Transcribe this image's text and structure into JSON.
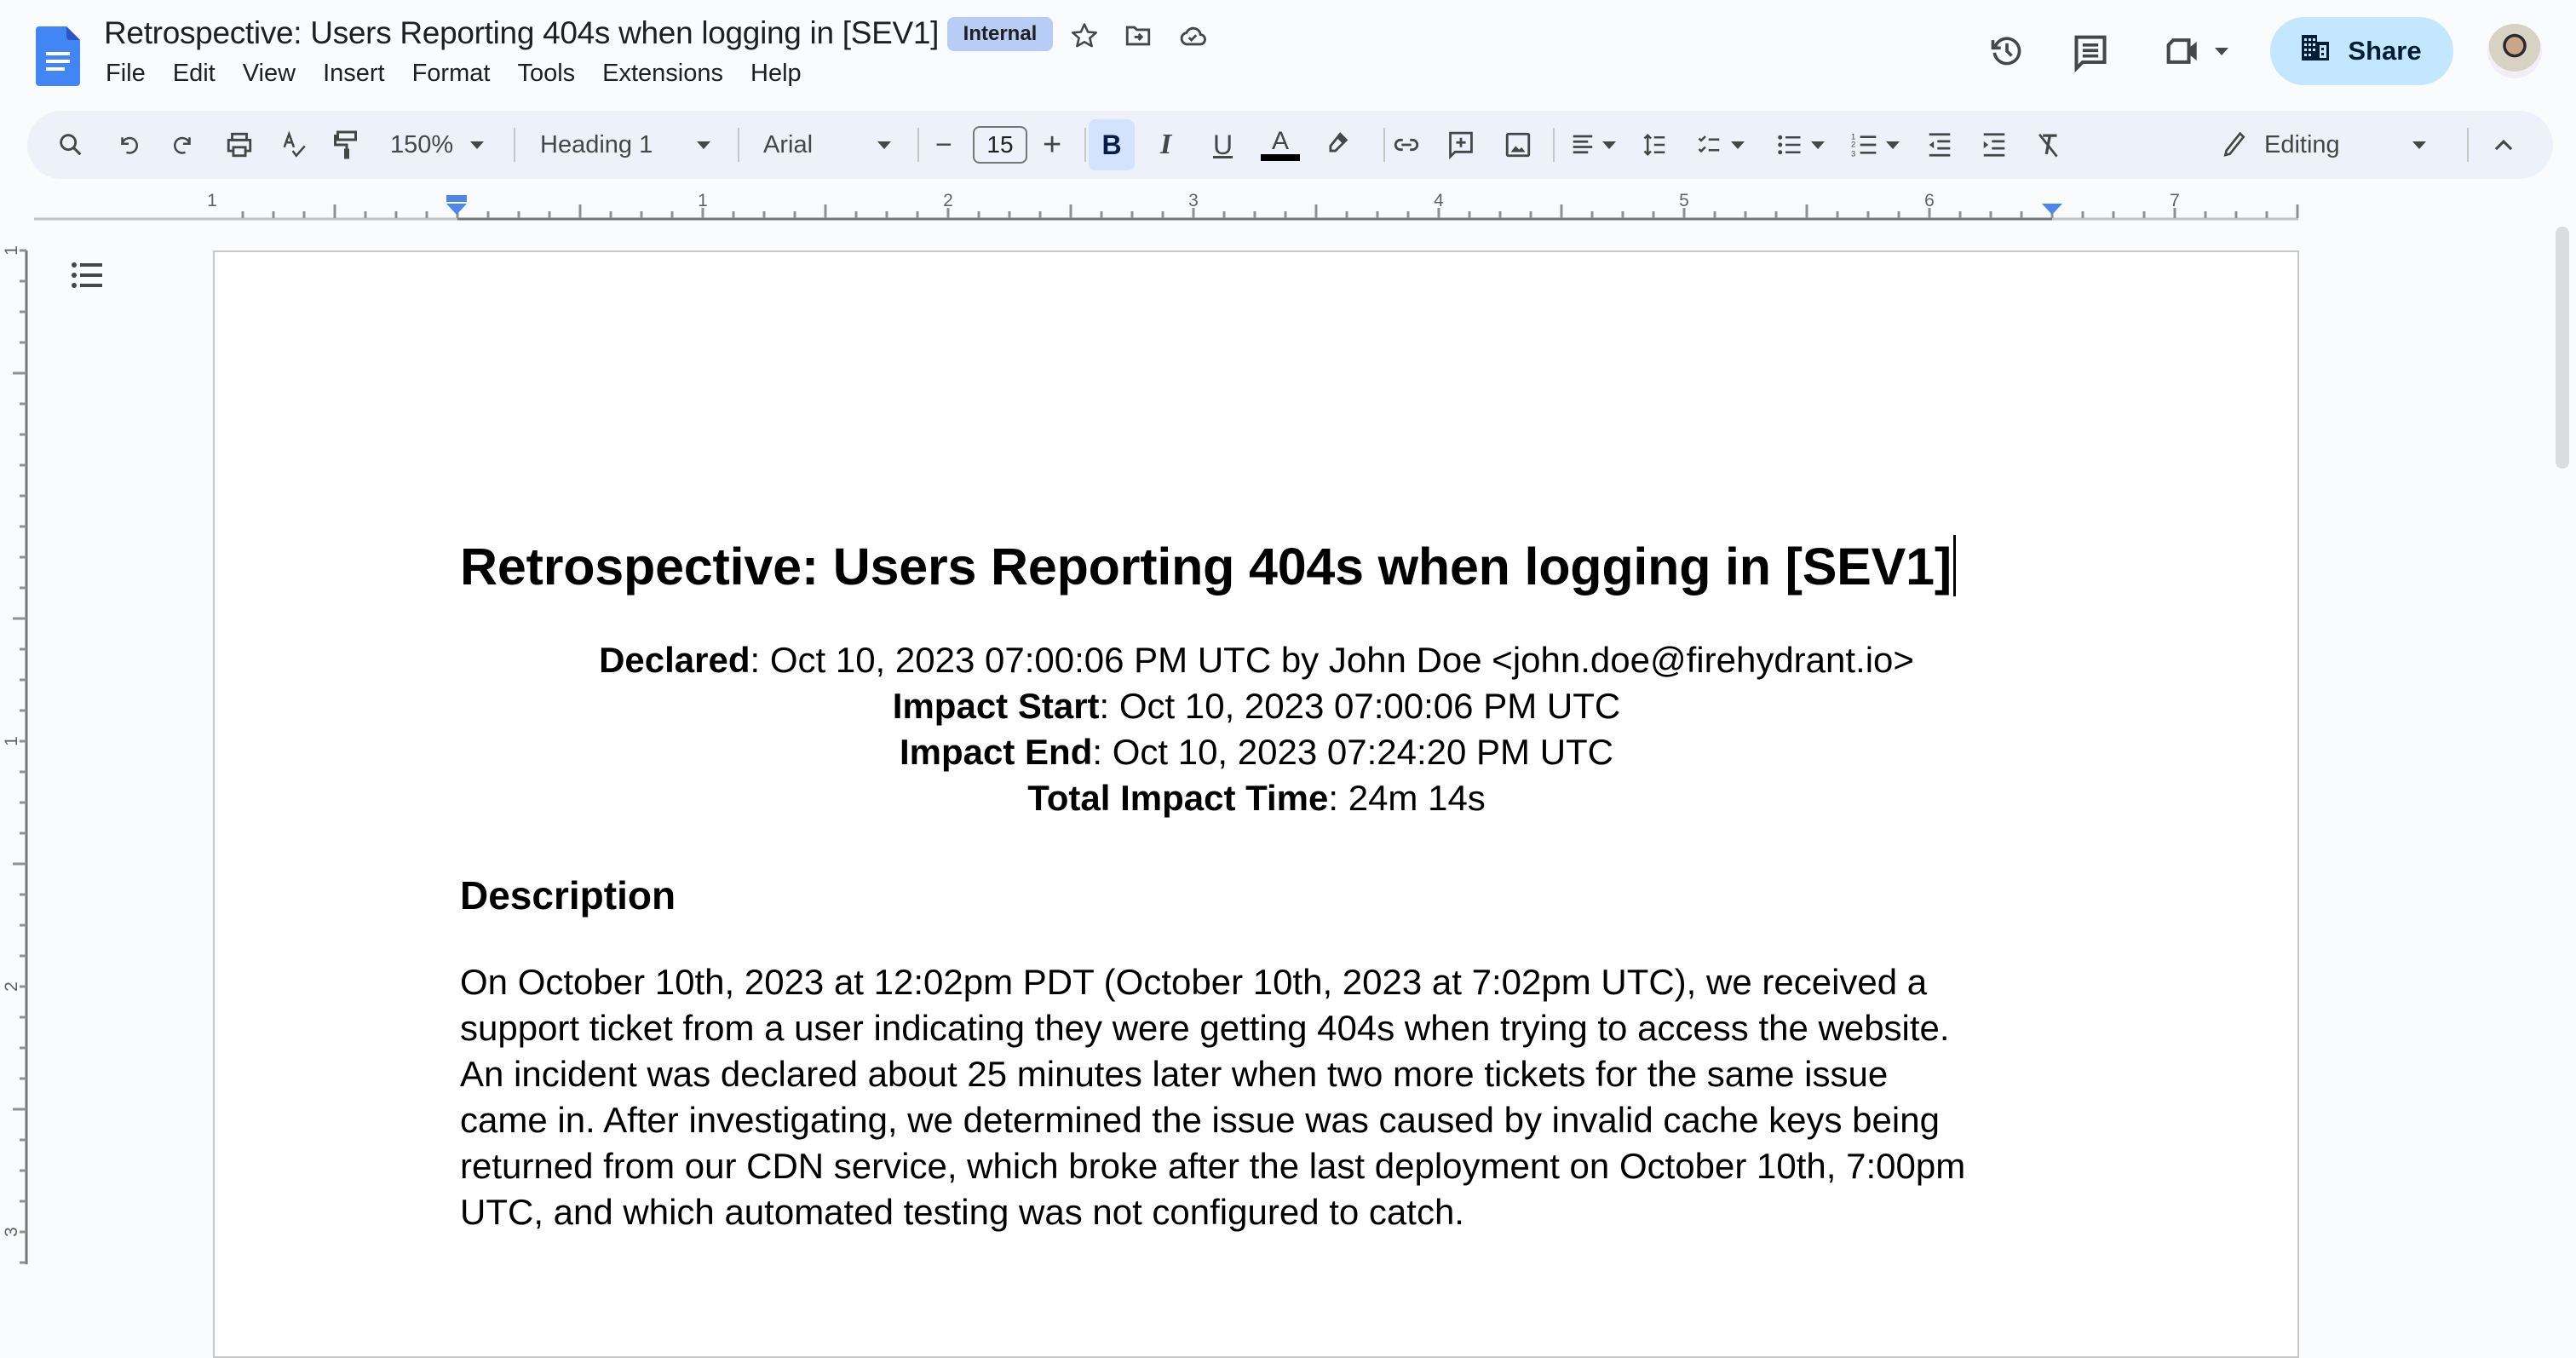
{
  "app": {
    "doc_title": "Retrospective: Users Reporting 404s when logging in [SEV1]",
    "label_badge": "Internal",
    "menu": [
      "File",
      "Edit",
      "View",
      "Insert",
      "Format",
      "Tools",
      "Extensions",
      "Help"
    ],
    "share_label": "Share",
    "colors": {
      "accent_blue": "#4285f4",
      "share_bg": "#c2e7ff",
      "badge_bg": "#b8cdf5",
      "toolbar_bg": "#edf2fa",
      "bold_active_bg": "#d3e3fd"
    }
  },
  "toolbar": {
    "zoom": "150%",
    "style": "Heading 1",
    "font": "Arial",
    "font_size": "15",
    "bold_label": "B",
    "italic_label": "I",
    "underline_label": "U",
    "text_color_label": "A",
    "mode": "Editing",
    "decrease_label": "−",
    "increase_label": "+"
  },
  "ruler": {
    "horizontal_labels": [
      "1",
      "1",
      "2",
      "3",
      "4",
      "5",
      "6",
      "7"
    ],
    "vertical_labels": [
      "1",
      "1",
      "2",
      "3"
    ]
  },
  "document": {
    "title": "Retrospective: Users Reporting 404s when logging in [SEV1]",
    "meta": [
      {
        "label": "Declared",
        "value": ": Oct 10, 2023 07:00:06 PM UTC by John Doe <john.doe@firehydrant.io>"
      },
      {
        "label": "Impact Start",
        "value": ": Oct 10, 2023 07:00:06 PM UTC"
      },
      {
        "label": "Impact End",
        "value": ": Oct 10, 2023 07:24:20 PM UTC"
      },
      {
        "label": "Total Impact Time",
        "value": ": 24m 14s"
      }
    ],
    "section_heading": "Description",
    "paragraph_lines": [
      "On October 10th, 2023 at 12:02pm PDT (October 10th, 2023 at 7:02pm UTC), we received a",
      "support ticket from a user indicating they were getting 404s when trying to access the website.",
      "An incident was declared about 25 minutes later when two more tickets for the same issue",
      "came in. After investigating, we determined the issue was caused by invalid cache keys being",
      "returned from our CDN service, which broke after the last deployment on October 10th, 7:00pm",
      "UTC, and which automated testing was not configured to catch."
    ]
  }
}
